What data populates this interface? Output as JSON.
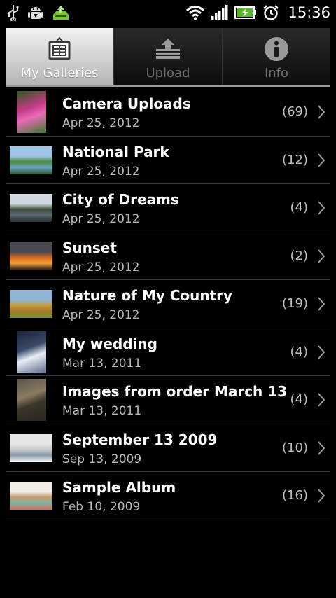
{
  "status_bar": {
    "time": "15:36",
    "icons": [
      "usb-icon",
      "android-debug-icon",
      "upload-notification-icon",
      "wifi-icon",
      "signal-icon",
      "battery-charging-icon",
      "alarm-clock-icon"
    ]
  },
  "tabs": [
    {
      "label": "My Galleries",
      "icon": "gallery-grid-icon",
      "active": true
    },
    {
      "label": "Upload",
      "icon": "upload-tray-icon",
      "active": false
    },
    {
      "label": "Info",
      "icon": "info-icon",
      "active": false
    }
  ],
  "galleries": [
    {
      "title": "Camera Uploads",
      "date": "Apr 25, 2012",
      "count": "(69)",
      "thumb": "tall",
      "colors": [
        "#2a5a1a",
        "#c43a86",
        "#e86ab8",
        "#3b7a2a"
      ]
    },
    {
      "title": "National Park",
      "date": "Apr 25, 2012",
      "count": "(12)",
      "thumb": "wide",
      "colors": [
        "#9cc4e6",
        "#4d8a3a",
        "#6aa3c7",
        "#2f5a28"
      ]
    },
    {
      "title": "City of Dreams",
      "date": "Apr 25, 2012",
      "count": "(4)",
      "thumb": "wide",
      "colors": [
        "#cfd8e0",
        "#3c4c3a",
        "#5a6b72",
        "#20282a"
      ]
    },
    {
      "title": "Sunset",
      "date": "Apr 25, 2012",
      "count": "(2)",
      "thumb": "wide",
      "colors": [
        "#4a4a52",
        "#d96a1e",
        "#f2a23a",
        "#1a1412"
      ]
    },
    {
      "title": "Nature of My Country",
      "date": "Apr 25, 2012",
      "count": "(19)",
      "thumb": "wide",
      "colors": [
        "#8fb6d8",
        "#c79a3c",
        "#a67b2a",
        "#7a8f3a"
      ]
    },
    {
      "title": "My wedding",
      "date": "Mar 13, 2011",
      "count": "(4)",
      "thumb": "tall",
      "colors": [
        "#1c2436",
        "#3a4a6a",
        "#e8eef6",
        "#5a6a8a"
      ]
    },
    {
      "title": "Images from order March 13",
      "date": "Mar 13, 2011",
      "count": "(4)",
      "thumb": "tall",
      "colors": [
        "#5a5448",
        "#8a7a60",
        "#3a3428",
        "#2a2620"
      ]
    },
    {
      "title": "September 13 2009",
      "date": "Sep 13, 2009",
      "count": "(10)",
      "thumb": "wide",
      "colors": [
        "#e6e6e6",
        "#c8cad0",
        "#8a9aa8",
        "#f4f4f4"
      ]
    },
    {
      "title": "Sample Album",
      "date": "Feb 10, 2009",
      "count": "(16)",
      "thumb": "wide",
      "colors": [
        "#f0ede6",
        "#c99a6a",
        "#7fb6a6",
        "#d86a5a"
      ]
    }
  ]
}
